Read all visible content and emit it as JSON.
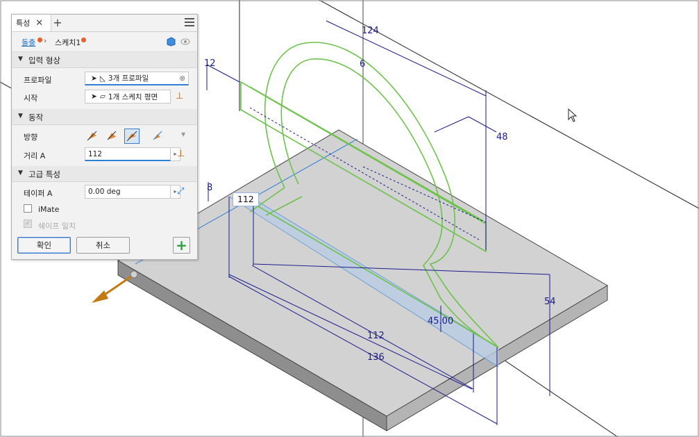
{
  "panel": {
    "tab_label": "특성",
    "breadcrumb": {
      "first": "돌출",
      "second": "스케치1"
    },
    "sections": {
      "input_shape": "입력 형상",
      "behavior": "동작",
      "advanced": "고급 특성"
    },
    "fields": {
      "profile_label": "프로파일",
      "profile_value": "3개 프로파일",
      "start_label": "시작",
      "start_value": "1개 스케치 평면",
      "direction_label": "방향",
      "distance_label": "거리 A",
      "distance_value": "112",
      "taper_label": "테이퍼 A",
      "taper_value": "0.00 deg",
      "imate_label": "iMate",
      "imate_checked": false,
      "match_shape_label": "쉐이프 일치",
      "match_shape_checked": true
    },
    "buttons": {
      "ok": "확인",
      "cancel": "취소"
    }
  },
  "viewport": {
    "dimensions": {
      "d124": "124",
      "d6": "6",
      "d12": "12",
      "d48": "48",
      "d8": "8",
      "d54": "54",
      "d45": "45.00",
      "d112": "112",
      "d136": "136"
    },
    "input_box_value": "112"
  },
  "colors": {
    "dimension": "#1a1a8c",
    "profile": "#6cc24a",
    "preview": "#b9cde3",
    "plate_top": "#d2d2d2",
    "accent": "#2d7fd6"
  }
}
